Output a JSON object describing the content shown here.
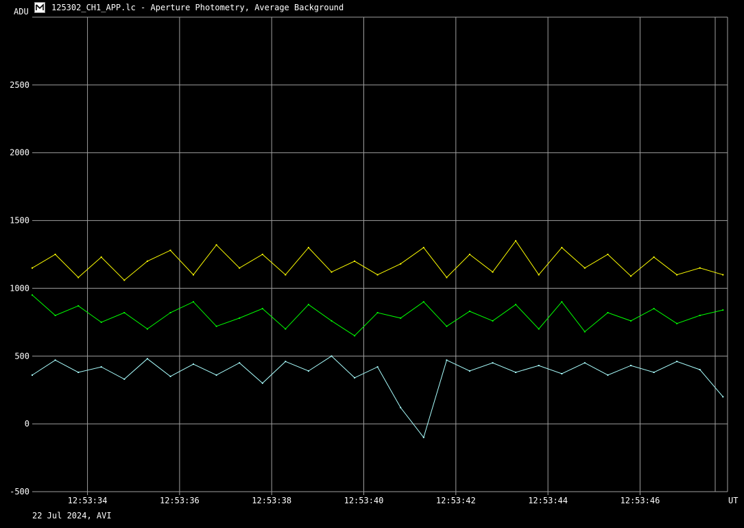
{
  "window": {
    "title": "125302_CH1_APP.lc - Aperture Photometry, Average Background",
    "icon": "lightcurve-app-icon"
  },
  "footer": {
    "date_label": "22 Jul 2024, AVI"
  },
  "colors": {
    "background": "#000000",
    "grid": "#a0a0a0",
    "series_yellow": "#ffff00",
    "series_green": "#00ff00",
    "series_cyan": "#aaffff"
  },
  "chart_data": {
    "type": "line",
    "title": "",
    "ylabel": "ADU",
    "xlabel": "UT",
    "ylim": [
      -500,
      3000
    ],
    "yticks": [
      -500,
      0,
      500,
      1000,
      1500,
      2000,
      2500
    ],
    "xlim": [
      "12:53:32.8",
      "12:53:47.9"
    ],
    "xticks": [
      "12:53:34",
      "12:53:36",
      "12:53:38",
      "12:53:40",
      "12:53:42",
      "12:53:44",
      "12:53:46"
    ],
    "xtick_seconds": [
      34,
      36,
      38,
      40,
      42,
      44,
      46
    ],
    "grid": true,
    "legend": "none",
    "x_seconds": [
      32.8,
      33.3,
      33.8,
      34.3,
      34.8,
      35.3,
      35.8,
      36.3,
      36.8,
      37.3,
      37.8,
      38.3,
      38.8,
      39.3,
      39.8,
      40.3,
      40.8,
      41.3,
      41.8,
      42.3,
      42.8,
      43.3,
      43.8,
      44.3,
      44.8,
      45.3,
      45.8,
      46.3,
      46.8,
      47.3,
      47.8
    ],
    "series": [
      {
        "name": "",
        "color": "#ffff00",
        "values": [
          1150,
          1250,
          1080,
          1230,
          1060,
          1200,
          1280,
          1100,
          1320,
          1150,
          1250,
          1100,
          1300,
          1120,
          1200,
          1100,
          1180,
          1300,
          1080,
          1250,
          1120,
          1350,
          1100,
          1300,
          1150,
          1250,
          1090,
          1230,
          1100,
          1150,
          1100
        ]
      },
      {
        "name": "",
        "color": "#00ff00",
        "values": [
          950,
          800,
          870,
          750,
          820,
          700,
          820,
          900,
          720,
          780,
          850,
          700,
          880,
          760,
          650,
          820,
          780,
          900,
          720,
          830,
          760,
          880,
          700,
          900,
          680,
          820,
          760,
          850,
          740,
          800,
          840
        ]
      },
      {
        "name": "",
        "color": "#aaffff",
        "values": [
          360,
          470,
          380,
          420,
          330,
          480,
          350,
          440,
          360,
          450,
          300,
          460,
          390,
          500,
          340,
          420,
          120,
          -100,
          470,
          390,
          450,
          380,
          430,
          370,
          450,
          360,
          430,
          380,
          460,
          400,
          200
        ]
      }
    ]
  }
}
